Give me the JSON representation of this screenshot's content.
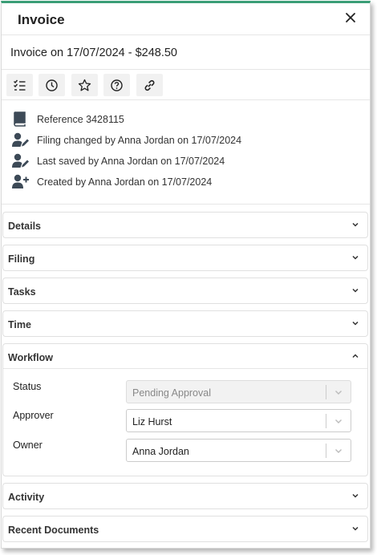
{
  "header": {
    "title": "Invoice"
  },
  "subheader": {
    "title": "Invoice on 17/07/2024 - $248.50"
  },
  "info": {
    "reference": "Reference 3428115",
    "filing_changed": "Filing changed by Anna Jordan on 17/07/2024",
    "last_saved": "Last saved by Anna Jordan on 17/07/2024",
    "created": "Created by Anna Jordan on 17/07/2024"
  },
  "sections": {
    "details": "Details",
    "filing": "Filing",
    "tasks": "Tasks",
    "time": "Time",
    "workflow": "Workflow",
    "activity": "Activity",
    "recent_documents": "Recent Documents"
  },
  "workflow": {
    "status_label": "Status",
    "status_value": "Pending Approval",
    "approver_label": "Approver",
    "approver_value": "Liz Hurst",
    "owner_label": "Owner",
    "owner_value": "Anna Jordan"
  },
  "colors": {
    "accent": "#3a9e76",
    "icon": "#3d4a57"
  }
}
